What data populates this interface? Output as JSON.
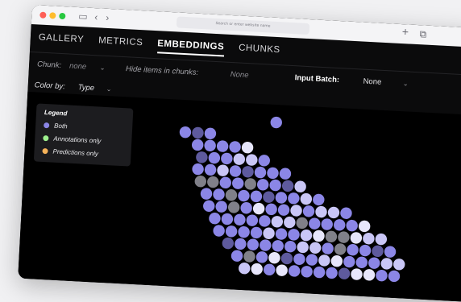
{
  "browser": {
    "address_placeholder": "Search or enter website name",
    "icons": [
      "sidebar-icon",
      "back-icon",
      "forward-icon",
      "new-tab-icon",
      "tabs-overview-icon"
    ]
  },
  "tabs": [
    {
      "label": "GALLERY"
    },
    {
      "label": "METRICS"
    },
    {
      "label": "EMBEDDINGS",
      "active": true
    },
    {
      "label": "CHUNKS"
    }
  ],
  "filters": {
    "chunk_label": "Chunk:",
    "chunk_value": "none",
    "hide_label": "Hide items in chunks:",
    "hide_value": "None",
    "input_batch_label": "Input Batch:",
    "input_batch_value": "None",
    "color_by_label": "Color by:",
    "color_by_value": "Type"
  },
  "legend": {
    "title": "Legend",
    "items": [
      {
        "label": "Both",
        "color": "#8b86e6"
      },
      {
        "label": "Annotations only",
        "color": "#9ef18f"
      },
      {
        "label": "Predictions only",
        "color": "#f5b259"
      }
    ]
  },
  "colors": {
    "both": "#8b86e6",
    "both_light": "#c9c6f6",
    "both_pale": "#e7e6fb",
    "both_dim": "#5e5a9e",
    "grey": "#808089"
  }
}
